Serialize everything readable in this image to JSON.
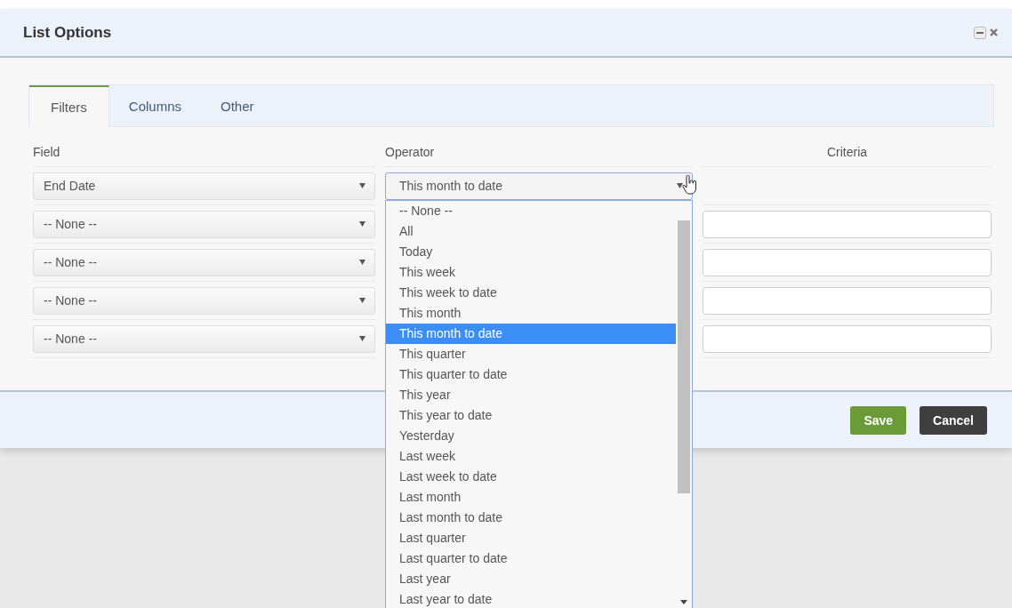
{
  "dialog": {
    "title": "List Options"
  },
  "tabs": [
    {
      "label": "Filters",
      "selected": true
    },
    {
      "label": "Columns",
      "selected": false
    },
    {
      "label": "Other",
      "selected": false
    }
  ],
  "columns": [
    "Field",
    "Operator",
    "Criteria"
  ],
  "rows": [
    {
      "field": "End Date",
      "operator": "This month to date",
      "criteria_visible": false
    },
    {
      "field": "-- None --",
      "criteria_visible": true
    },
    {
      "field": "-- None --",
      "criteria_visible": true
    },
    {
      "field": "-- None --",
      "criteria_visible": true
    },
    {
      "field": "-- None --",
      "criteria_visible": true
    }
  ],
  "operator_options": [
    {
      "label": "-- None --",
      "selected": false
    },
    {
      "label": "All",
      "selected": false
    },
    {
      "label": "Today",
      "selected": false
    },
    {
      "label": "This week",
      "selected": false
    },
    {
      "label": "This week to date",
      "selected": false
    },
    {
      "label": "This month",
      "selected": false
    },
    {
      "label": "This month to date",
      "selected": true
    },
    {
      "label": "This quarter",
      "selected": false
    },
    {
      "label": "This quarter to date",
      "selected": false
    },
    {
      "label": "This year",
      "selected": false
    },
    {
      "label": "This year to date",
      "selected": false
    },
    {
      "label": "Yesterday",
      "selected": false
    },
    {
      "label": "Last week",
      "selected": false
    },
    {
      "label": "Last week to date",
      "selected": false
    },
    {
      "label": "Last month",
      "selected": false
    },
    {
      "label": "Last month to date",
      "selected": false
    },
    {
      "label": "Last quarter",
      "selected": false
    },
    {
      "label": "Last quarter to date",
      "selected": false
    },
    {
      "label": "Last year",
      "selected": false
    },
    {
      "label": "Last year to date",
      "selected": false
    }
  ],
  "buttons": [
    {
      "label": "Save",
      "kind": "primary"
    },
    {
      "label": "Cancel",
      "kind": "secondary"
    }
  ]
}
